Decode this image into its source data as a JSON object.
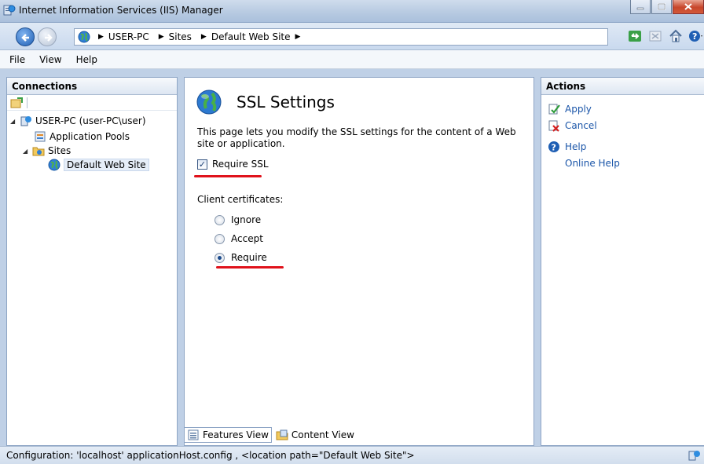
{
  "window": {
    "title": "Internet Information Services (IIS) Manager"
  },
  "breadcrumb": [
    "USER-PC",
    "Sites",
    "Default Web Site"
  ],
  "menu": [
    "File",
    "View",
    "Help"
  ],
  "connections": {
    "header": "Connections",
    "tree": [
      {
        "label": "USER-PC (user-PC\\user)",
        "icon": "server-icon",
        "expanded": true
      },
      {
        "label": "Application Pools",
        "icon": "app-pools-icon"
      },
      {
        "label": "Sites",
        "icon": "sites-folder-icon",
        "expanded": true
      },
      {
        "label": "Default Web Site",
        "icon": "globe-icon",
        "selected": true
      }
    ]
  },
  "feature": {
    "title": "SSL Settings",
    "description": "This page lets you modify the SSL settings for the content of a Web site or application.",
    "require_ssl_label": "Require SSL",
    "require_ssl_checked": true,
    "client_certificates_label": "Client certificates:",
    "options": [
      {
        "label": "Ignore",
        "checked": false
      },
      {
        "label": "Accept",
        "checked": false
      },
      {
        "label": "Require",
        "checked": true
      }
    ]
  },
  "views": {
    "features": "Features View",
    "content": "Content View",
    "active": "features"
  },
  "actions": {
    "header": "Actions",
    "items": [
      {
        "label": "Apply",
        "icon": "apply-icon"
      },
      {
        "label": "Cancel",
        "icon": "cancel-icon"
      },
      {
        "label": "Help",
        "icon": "help-icon"
      },
      {
        "label": "Online Help",
        "icon": ""
      }
    ]
  },
  "status": {
    "text": "Configuration: 'localhost' applicationHost.config , <location path=\"Default Web Site\">"
  },
  "colors": {
    "accent_link": "#1a55a8",
    "highlight_red": "#e0121b",
    "pane_border": "#8ea5c5"
  }
}
